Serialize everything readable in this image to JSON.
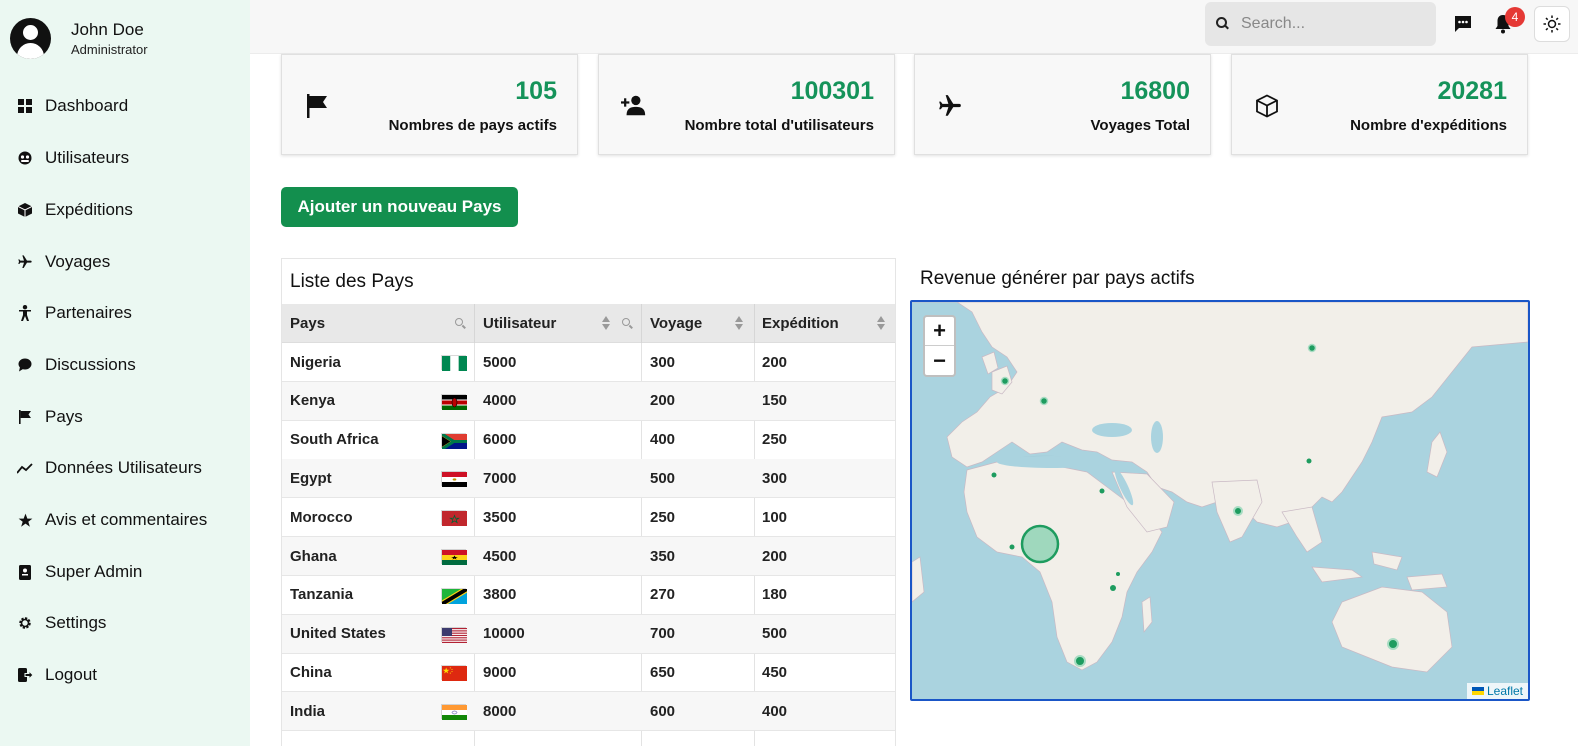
{
  "user": {
    "name": "John Doe",
    "role": "Administrator"
  },
  "nav": [
    {
      "label": "Dashboard",
      "icon": "grid-icon"
    },
    {
      "label": "Utilisateurs",
      "icon": "users-icon"
    },
    {
      "label": "Expéditions",
      "icon": "box-icon"
    },
    {
      "label": "Voyages",
      "icon": "plane-icon"
    },
    {
      "label": "Partenaires",
      "icon": "person-icon"
    },
    {
      "label": "Discussions",
      "icon": "chat-icon"
    },
    {
      "label": "Pays",
      "icon": "flag-icon"
    },
    {
      "label": "Données Utilisateurs",
      "icon": "trend-icon"
    },
    {
      "label": "Avis et commentaires",
      "icon": "star-icon"
    },
    {
      "label": "Super Admin",
      "icon": "badge-icon"
    },
    {
      "label": "Settings",
      "icon": "gear-icon"
    },
    {
      "label": "Logout",
      "icon": "logout-icon"
    }
  ],
  "topbar": {
    "search_placeholder": "Search...",
    "notification_count": "4"
  },
  "stats": [
    {
      "value": "105",
      "label": "Nombres de pays actifs",
      "icon": "flag-icon"
    },
    {
      "value": "100301",
      "label": "Nombre total d'utilisateurs",
      "icon": "user-plus-icon"
    },
    {
      "value": "16800",
      "label": "Voyages Total",
      "icon": "plane-icon"
    },
    {
      "value": "20281",
      "label": "Nombre d'expéditions",
      "icon": "box-icon"
    }
  ],
  "add_button": "Ajouter un nouveau Pays",
  "table": {
    "title": "Liste des Pays",
    "columns": [
      "Pays",
      "Utilisateur",
      "Voyage",
      "Expédition"
    ],
    "rows": [
      {
        "country": "Nigeria",
        "users": "5000",
        "voyages": "300",
        "expeditions": "200"
      },
      {
        "country": "Kenya",
        "users": "4000",
        "voyages": "200",
        "expeditions": "150"
      },
      {
        "country": "South Africa",
        "users": "6000",
        "voyages": "400",
        "expeditions": "250"
      },
      {
        "country": "Egypt",
        "users": "7000",
        "voyages": "500",
        "expeditions": "300"
      },
      {
        "country": "Morocco",
        "users": "3500",
        "voyages": "250",
        "expeditions": "100"
      },
      {
        "country": "Ghana",
        "users": "4500",
        "voyages": "350",
        "expeditions": "200"
      },
      {
        "country": "Tanzania",
        "users": "3800",
        "voyages": "270",
        "expeditions": "180"
      },
      {
        "country": "United States",
        "users": "10000",
        "voyages": "700",
        "expeditions": "500"
      },
      {
        "country": "China",
        "users": "9000",
        "voyages": "650",
        "expeditions": "450"
      },
      {
        "country": "India",
        "users": "8000",
        "voyages": "600",
        "expeditions": "400"
      }
    ]
  },
  "map": {
    "title": "Revenue générer par pays actifs",
    "zoom_in": "+",
    "zoom_out": "−",
    "attribution": "Leaflet"
  },
  "colors": {
    "accent": "#138f4e",
    "stat_value": "#15935a",
    "sidebar_bg": "#ebf8f2",
    "map_border": "#1a56c7",
    "badge": "#e53935"
  }
}
